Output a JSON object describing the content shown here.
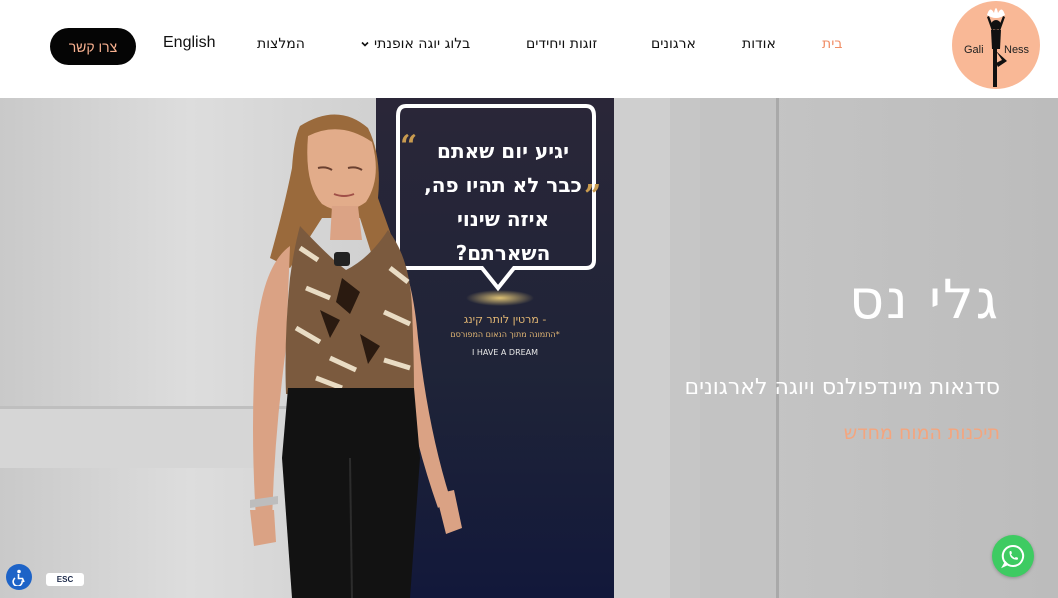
{
  "header": {
    "logo": {
      "left_text": "Gali",
      "right_text": "Ness"
    },
    "nav": [
      {
        "key": "home",
        "label": "בית",
        "active": true
      },
      {
        "key": "about",
        "label": "אודות",
        "active": false
      },
      {
        "key": "orgs",
        "label": "ארגונים",
        "active": false
      },
      {
        "key": "couples",
        "label": "זוגות ויחידים",
        "active": false
      },
      {
        "key": "blog",
        "label": "בלוג יוגה אופנתי",
        "active": false,
        "has_dropdown": true
      },
      {
        "key": "recs",
        "label": "המלצות",
        "active": false
      }
    ],
    "language_link": "English",
    "contact_button": "צרו קשר"
  },
  "hero": {
    "title": "גלי נס",
    "subtitle": "סדנאות מיינדפולנס ויוגה לארגונים",
    "tagline": "תיכנות המוח מחדש"
  },
  "banner": {
    "quote_lines": [
      "יגיע יום שאתם",
      "כבר לא תהיו פה,",
      "איזה שינוי",
      "השארתם?"
    ],
    "author": "- מרטין לותר קינג",
    "note": "*התמונה מתוך הנאום המפורסם",
    "dream": "I HAVE A DREAM"
  },
  "widgets": {
    "esc_label": "ESC"
  },
  "colors": {
    "accent": "#f08e66",
    "logo_bg": "#f9b896",
    "contact_bg": "#050505",
    "contact_text": "#f7b08f",
    "whatsapp": "#3ecb62",
    "a11y": "#1d63c7"
  }
}
